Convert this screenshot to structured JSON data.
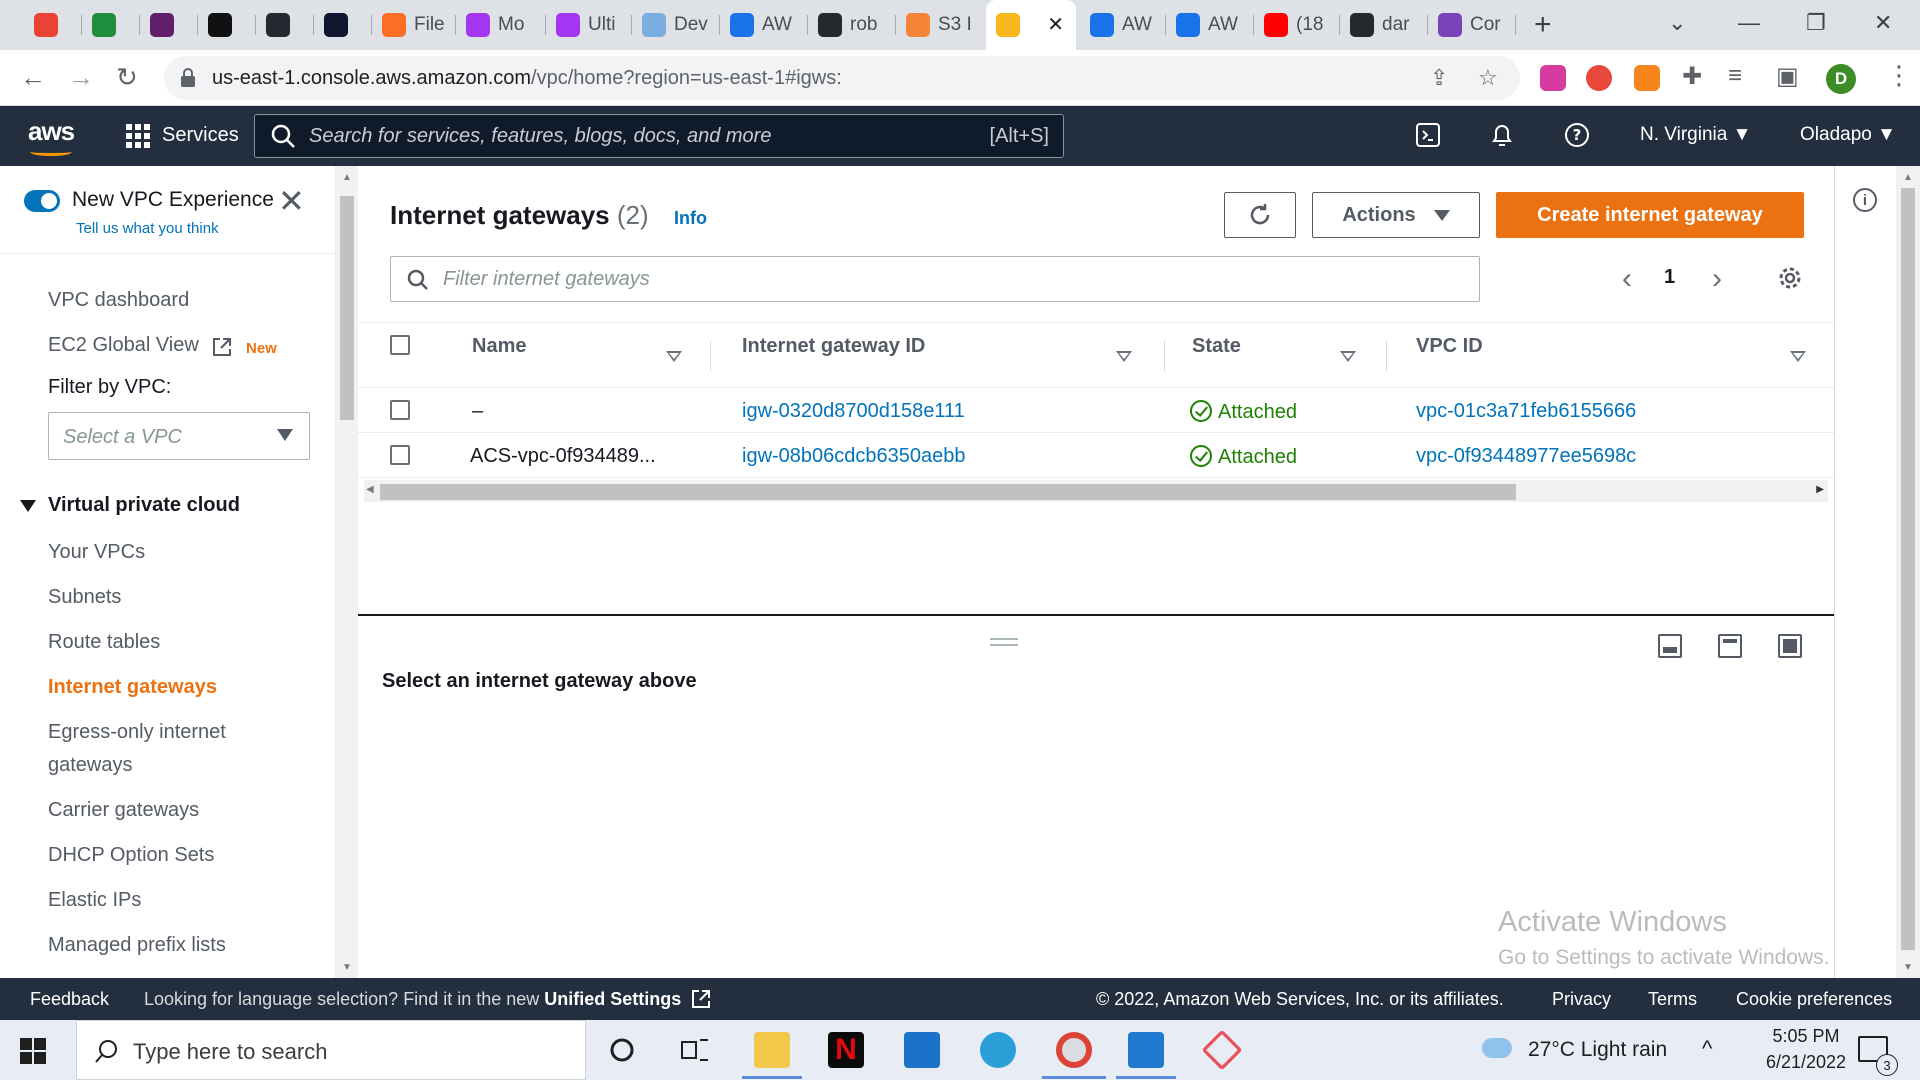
{
  "browser": {
    "tabs": [
      {
        "label": "",
        "icon": "gmail-icon",
        "color": "#ea4335"
      },
      {
        "label": "",
        "icon": "sheets-plus-icon",
        "color": "#1e8e3e"
      },
      {
        "label": "",
        "icon": "slack-icon",
        "color": "#611f69"
      },
      {
        "label": "",
        "icon": "amazon-icon",
        "color": "#111111"
      },
      {
        "label": "",
        "icon": "github-icon",
        "color": "#24292f"
      },
      {
        "label": "",
        "icon": "codecademy-icon",
        "color": "#10162f"
      },
      {
        "label": "File",
        "icon": "gitlab-icon",
        "color": "#fc6d26"
      },
      {
        "label": "Mo",
        "icon": "udemy-icon",
        "color": "#a435f0"
      },
      {
        "label": "Ulti",
        "icon": "udemy-icon",
        "color": "#a435f0"
      },
      {
        "label": "Dev",
        "icon": "cloud-house-icon",
        "color": "#7baee0"
      },
      {
        "label": "AW",
        "icon": "aws-cloud-icon",
        "color": "#1a73e8"
      },
      {
        "label": "rob",
        "icon": "github-icon",
        "color": "#24292f"
      },
      {
        "label": "S3 I",
        "icon": "s3-box-icon",
        "color": "#f58536"
      },
      {
        "label": "",
        "icon": "aws-box-icon",
        "color": "#f7b71d"
      },
      {
        "label": "AW",
        "icon": "aws-cloud-icon",
        "color": "#1a73e8"
      },
      {
        "label": "AW",
        "icon": "aws-cloud-icon",
        "color": "#1a73e8"
      },
      {
        "label": "(18",
        "icon": "youtube-icon",
        "color": "#ff0000"
      },
      {
        "label": "dar",
        "icon": "github-icon",
        "color": "#24292f"
      },
      {
        "label": "Cor",
        "icon": "terraform-icon",
        "color": "#7b42bc"
      }
    ],
    "url_host": "us-east-1.console.aws.amazon.com",
    "url_path": "/vpc/home?region=us-east-1#igws:",
    "profile_initial": "D"
  },
  "aws_header": {
    "logo": "aws",
    "services_label": "Services",
    "search_placeholder": "Search for services, features, blogs, docs, and more",
    "search_shortcut": "[Alt+S]",
    "region": "N. Virginia",
    "account": "Oladapo"
  },
  "sidenav": {
    "new_experience_title": "New VPC Experience",
    "new_experience_sub": "Tell us what you think",
    "top_items": [
      "VPC dashboard",
      "EC2 Global View"
    ],
    "new_badge": "New",
    "filter_label": "Filter by VPC:",
    "filter_placeholder": "Select a VPC",
    "section_title": "Virtual private cloud",
    "section_items": [
      "Your VPCs",
      "Subnets",
      "Route tables",
      "Internet gateways",
      "Egress-only internet",
      "gateways",
      "Carrier gateways",
      "DHCP Option Sets",
      "Elastic IPs",
      "Managed prefix lists"
    ],
    "active_item": "Internet gateways"
  },
  "main": {
    "title": "Internet gateways",
    "count": "(2)",
    "info": "Info",
    "actions_label": "Actions",
    "create_label": "Create internet gateway",
    "filter_placeholder": "Filter internet gateways",
    "page": "1",
    "columns": [
      "Name",
      "Internet gateway ID",
      "State",
      "VPC ID"
    ],
    "rows": [
      {
        "name": "–",
        "id": "igw-0320d8700d158e111",
        "state": "Attached",
        "vpc": "vpc-01c3a71feb6155666"
      },
      {
        "name": "ACS-vpc-0f934489...",
        "id": "igw-08b06cdcb6350aebb",
        "state": "Attached",
        "vpc": "vpc-0f93448977ee5698c"
      }
    ],
    "detail_message": "Select an internet gateway above",
    "watermark_title": "Activate Windows",
    "watermark_sub": "Go to Settings to activate Windows."
  },
  "footer": {
    "feedback": "Feedback",
    "lang_prefix": "Looking for language selection? Find it in the new",
    "lang_link": "Unified Settings",
    "copyright": "© 2022, Amazon Web Services, Inc. or its affiliates.",
    "privacy": "Privacy",
    "terms": "Terms",
    "cookies": "Cookie preferences"
  },
  "taskbar": {
    "search_placeholder": "Type here to search",
    "weather": "27°C  Light rain",
    "time": "5:05 PM",
    "date": "6/21/2022",
    "notifications": "3"
  },
  "colors": {
    "aws_navy": "#232f3e",
    "aws_orange": "#ec7211",
    "link_blue": "#0073bb",
    "success_green": "#1d8102"
  }
}
